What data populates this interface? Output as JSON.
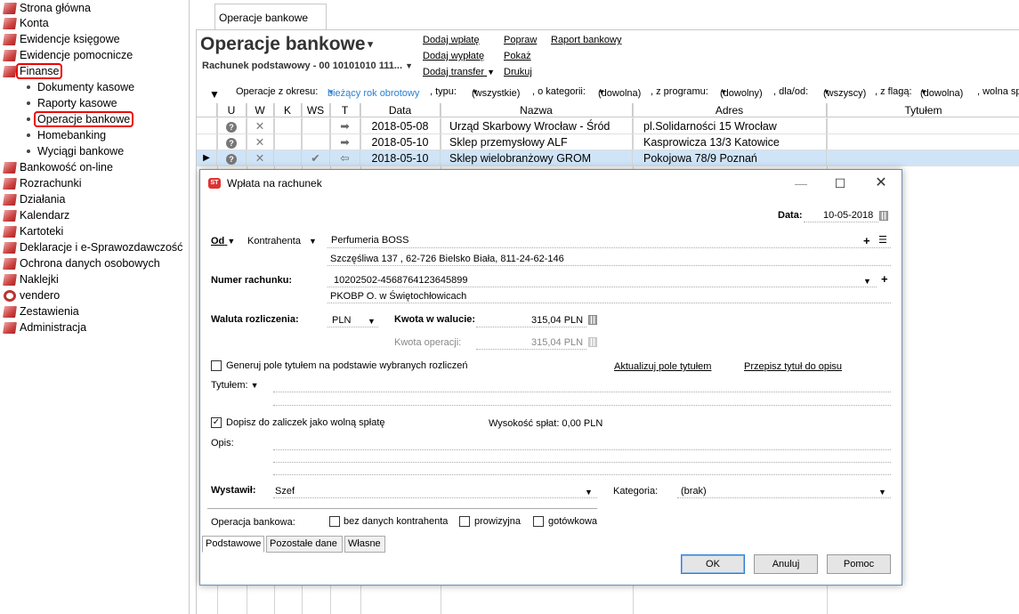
{
  "sidebar": {
    "items": [
      {
        "label": "Strona główna",
        "icon": "home-book-icon"
      },
      {
        "label": "Konta",
        "icon": "book-icon"
      },
      {
        "label": "Ewidencje księgowe",
        "icon": "book-icon"
      },
      {
        "label": "Ewidencje pomocnicze",
        "icon": "book-icon"
      },
      {
        "label": "Finanse",
        "icon": "book-icon"
      },
      {
        "label": "Bankowość on-line",
        "icon": "book-icon"
      },
      {
        "label": "Rozrachunki",
        "icon": "book-icon"
      },
      {
        "label": "Działania",
        "icon": "book-icon"
      },
      {
        "label": "Kalendarz",
        "icon": "book-icon"
      },
      {
        "label": "Kartoteki",
        "icon": "book-icon"
      },
      {
        "label": "Deklaracje i e-Sprawozdawczość",
        "icon": "book-icon"
      },
      {
        "label": "Ochrona danych osobowych",
        "icon": "book-icon"
      },
      {
        "label": "Naklejki",
        "icon": "book-icon"
      },
      {
        "label": "vendero",
        "icon": "gear-icon"
      },
      {
        "label": "Zestawienia",
        "icon": "book-icon"
      },
      {
        "label": "Administracja",
        "icon": "book-icon"
      }
    ],
    "finanse_sub": [
      "Dokumenty kasowe",
      "Raporty kasowe",
      "Operacje bankowe",
      "Homebanking",
      "Wyciągi bankowe"
    ]
  },
  "tab": {
    "label": "Operacje bankowe"
  },
  "header": {
    "title": "Operacje bankowe",
    "account": "Rachunek podstawowy - 00 10101010 111...",
    "actions": {
      "dodaj_wplate": "Dodaj wpłatę",
      "dodaj_wyplate": "Dodaj wypłatę",
      "dodaj_transfer": "Dodaj transfer",
      "popraw": "Popraw",
      "pokaz": "Pokaż",
      "drukuj": "Drukuj",
      "raport": "Raport bankowy"
    }
  },
  "filters": {
    "okres_label": "Operacje z okresu:",
    "okres_value": "bieżący rok obrotowy",
    "typ_label": ", typu:",
    "typ_value": "(wszystkie)",
    "kategoria_label": ", o kategorii:",
    "kategoria_value": "(dowolna)",
    "program_label": ", z programu:",
    "program_value": "(dowolny)",
    "dlaod_label": ", dla/od:",
    "dlaod_value": "(wszyscy)",
    "flaga_label": ", z flagą:",
    "flaga_value": "(dowolna)",
    "wolna_label": ", wolna sp"
  },
  "grid": {
    "columns": [
      "U",
      "W",
      "K",
      "WS",
      "T",
      "Data",
      "Nazwa",
      "Adres",
      "Tytułem"
    ],
    "rows": [
      {
        "data": "2018-05-08",
        "nazwa": "Urząd Skarbowy Wrocław - Śród",
        "adres": "pl.Solidarności 15 Wrocław",
        "ws": "",
        "t": "➡"
      },
      {
        "data": "2018-05-10",
        "nazwa": "Sklep przemysłowy ALF",
        "adres": "Kasprowicza  13/3  Katowice",
        "ws": "",
        "t": "➡"
      },
      {
        "data": "2018-05-10",
        "nazwa": "Sklep wielobranżowy GROM",
        "adres": "Pokojowa  78/9  Poznań",
        "ws": "✔",
        "t": "⇦"
      }
    ]
  },
  "dialog": {
    "title": "Wpłata na rachunek",
    "logo": "ST",
    "data_label": "Data:",
    "data_value": "10-05-2018",
    "od_label": "Od",
    "od_type": "Kontrahenta",
    "contractor_name": "Perfumeria BOSS",
    "contractor_address": "Szczęśliwa  137 , 62-726 Bielsko Biała, 811-24-62-146",
    "account_label": "Numer rachunku:",
    "account_number": "10202502-4568764123645899",
    "bank_name": "PKOBP O. w Świętochłowicach",
    "waluta_label": "Waluta rozliczenia:",
    "waluta_value": "PLN",
    "kwota_waluta_label": "Kwota w walucie:",
    "kwota_waluta_value": "315,04 PLN",
    "kwota_operacji_label": "Kwota operacji:",
    "kwota_operacji_value": "315,04 PLN",
    "generuj_label": "Generuj pole tytułem na podstawie wybranych rozliczeń",
    "aktualizuj_link": "Aktualizuj pole tytułem",
    "przepisz_link": "Przepisz tytuł do opisu",
    "tytulem_label": "Tytułem:",
    "dopisz_label": "Dopisz do zaliczek jako wolną spłatę",
    "wysokosc_label": "Wysokość spłat: 0,00 PLN",
    "opis_label": "Opis:",
    "wystawil_label": "Wystawił:",
    "wystawil_value": "Szef",
    "kategoria_label": "Kategoria:",
    "kategoria_value": "(brak)",
    "operacja_label": "Operacja bankowa:",
    "bez_danych_label": "bez danych kontrahenta",
    "prowizyjna_label": "prowizyjna",
    "gotowkowa_label": "gotówkowa",
    "tabs": [
      "Podstawowe",
      "Pozostałe dane",
      "Własne"
    ],
    "ok_label": "OK",
    "anuluj_label": "Anuluj",
    "pomoc_label": "Pomoc"
  }
}
